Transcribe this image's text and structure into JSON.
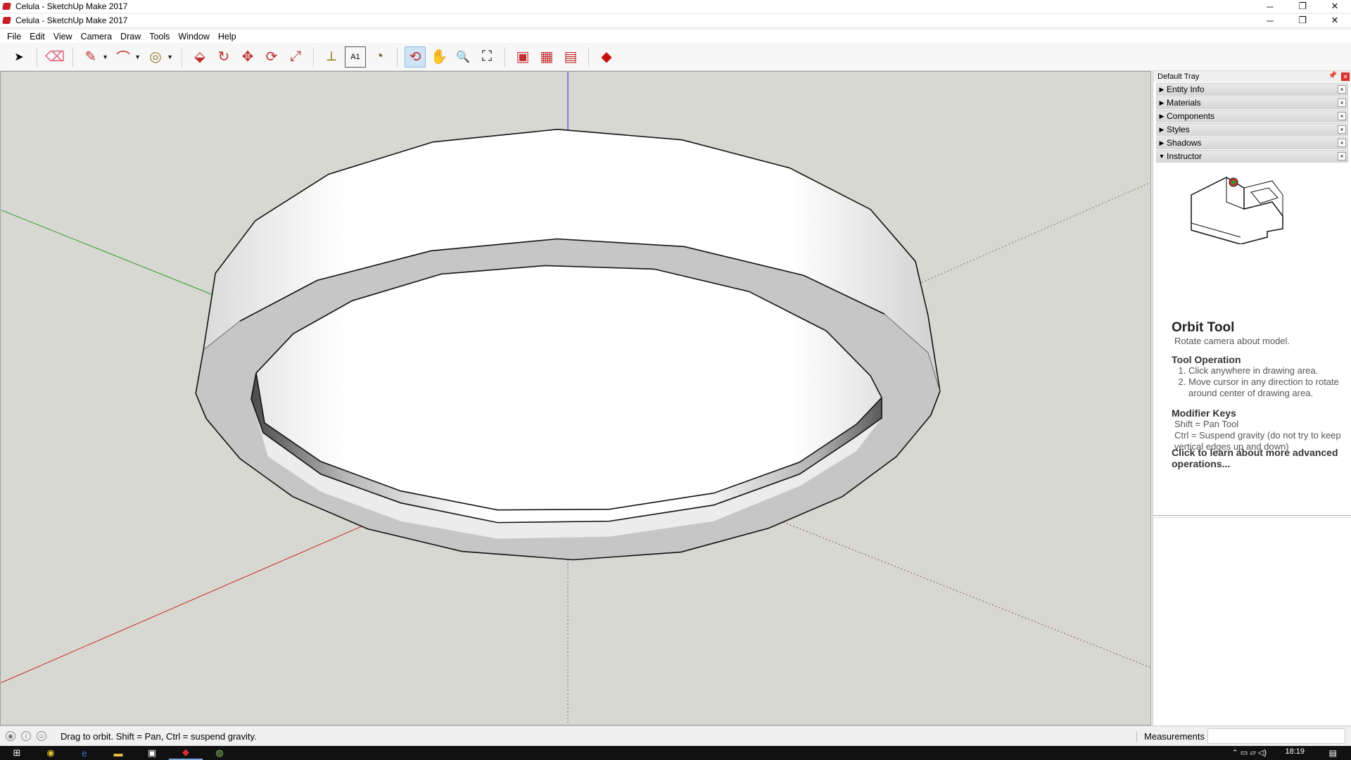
{
  "window": {
    "title_back": "Celula - SketchUp Make 2017",
    "title_front": "Celula - SketchUp Make 2017",
    "controls": {
      "minimize": "─",
      "restore": "❐",
      "close": "✕"
    }
  },
  "menu": [
    "File",
    "Edit",
    "View",
    "Camera",
    "Draw",
    "Tools",
    "Window",
    "Help"
  ],
  "toolbar": {
    "tools": [
      {
        "name": "select-tool",
        "icon": "➤"
      },
      {
        "name": "eraser-tool",
        "icon": "⌫"
      },
      {
        "name": "line-tool",
        "icon": "✎"
      },
      {
        "name": "arc-tool",
        "icon": "⌒"
      },
      {
        "name": "circle-tool",
        "icon": "◎"
      },
      {
        "name": "push-pull-tool",
        "icon": "⬙"
      },
      {
        "name": "follow-me-tool",
        "icon": "↻"
      },
      {
        "name": "move-tool",
        "icon": "✥"
      },
      {
        "name": "rotate-tool",
        "icon": "⟳"
      },
      {
        "name": "scale-tool",
        "icon": "⤢"
      },
      {
        "name": "tape-measure-tool",
        "icon": "⟂"
      },
      {
        "name": "text-tool",
        "icon": "A1"
      },
      {
        "name": "paint-bucket-tool",
        "icon": "◔"
      },
      {
        "name": "orbit-tool",
        "icon": "⟲"
      },
      {
        "name": "pan-tool",
        "icon": "✋"
      },
      {
        "name": "zoom-tool",
        "icon": "🔍"
      },
      {
        "name": "zoom-extents-tool",
        "icon": "⛶"
      },
      {
        "name": "3d-warehouse",
        "icon": "▣"
      },
      {
        "name": "extension-warehouse",
        "icon": "▦"
      },
      {
        "name": "send-to-layout",
        "icon": "▤"
      },
      {
        "name": "ruby-console",
        "icon": "◆"
      }
    ]
  },
  "tray": {
    "title": "Default Tray",
    "panels": [
      {
        "label": "Entity Info",
        "expanded": false
      },
      {
        "label": "Materials",
        "expanded": false
      },
      {
        "label": "Components",
        "expanded": false
      },
      {
        "label": "Styles",
        "expanded": false
      },
      {
        "label": "Shadows",
        "expanded": false
      },
      {
        "label": "Instructor",
        "expanded": true
      }
    ],
    "instructor": {
      "title": "Orbit Tool",
      "subtitle": "Rotate camera about model.",
      "operation_heading": "Tool Operation",
      "steps": [
        "Click anywhere in drawing area.",
        "Move cursor in any direction to rotate around center of drawing area."
      ],
      "modifier_heading": "Modifier Keys",
      "modifiers": [
        "Shift = Pan Tool",
        "Ctrl = Suspend gravity (do not try to keep vertical edges up and down)"
      ],
      "link": "Click to learn about more advanced operations..."
    }
  },
  "statusbar": {
    "message": "Drag to orbit. Shift = Pan, Ctrl = suspend gravity.",
    "measurements_label": "Measurements",
    "measurements_value": ""
  },
  "taskbar": {
    "clock": "18:19"
  },
  "colors": {
    "viewport_bg": "#d8d8d3",
    "axis_red": "#c82828",
    "axis_green": "#2a9a2a",
    "axis_blue": "#2a2ad0",
    "active_tool_bg": "#cfe3f7"
  }
}
